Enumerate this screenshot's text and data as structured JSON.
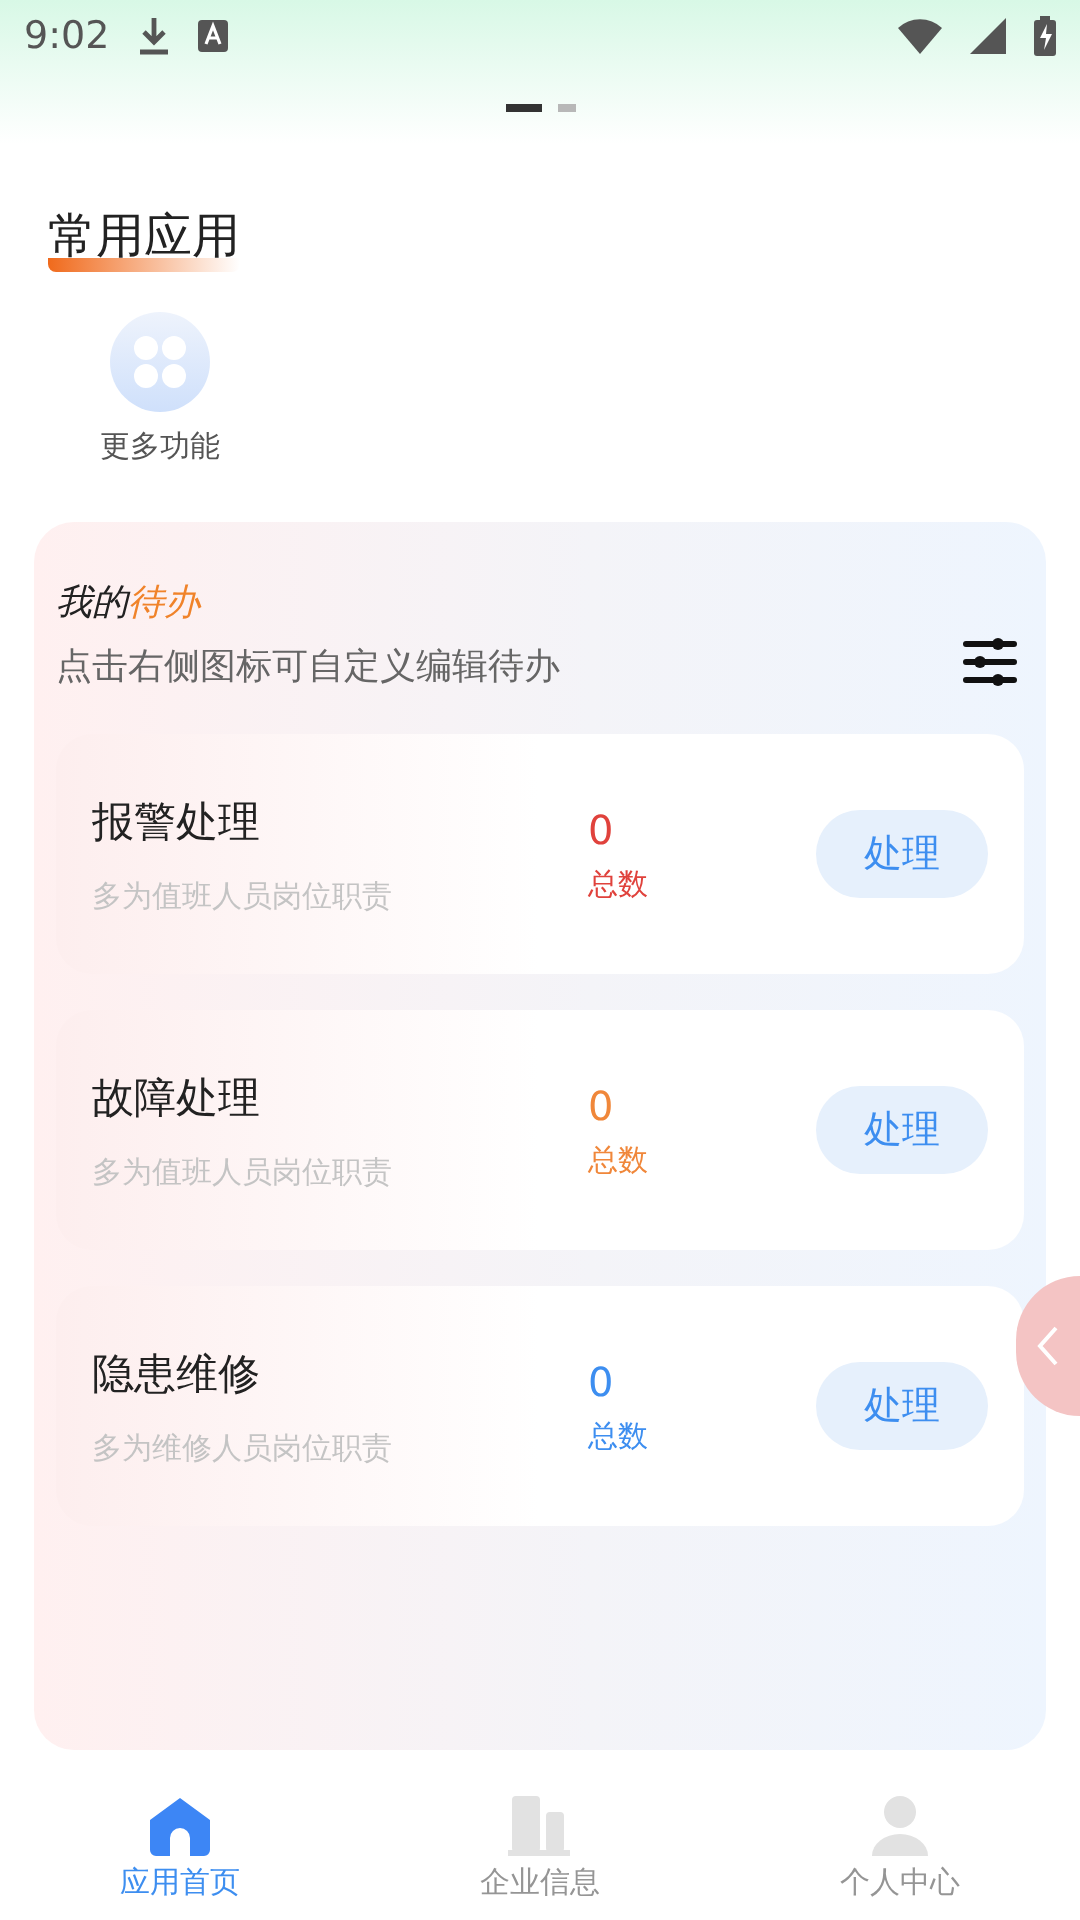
{
  "status_bar": {
    "time": "9:02"
  },
  "pager": [
    {
      "selected": true
    },
    {
      "selected": false
    }
  ],
  "section_title": "常用应用",
  "apps": [
    {
      "label": "更多功能"
    }
  ],
  "todo": {
    "title_plain": "我的",
    "title_accent": "待办",
    "hint": "点击右侧图标可自定义编辑待办",
    "tasks": [
      {
        "title": "报警处理",
        "desc": "多为值班人员岗位职责",
        "count": "0",
        "count_label": "总数",
        "color": "#e0423c",
        "action": "处理"
      },
      {
        "title": "故障处理",
        "desc": "多为值班人员岗位职责",
        "count": "0",
        "count_label": "总数",
        "color": "#f0873a",
        "action": "处理"
      },
      {
        "title": "隐患维修",
        "desc": "多为维修人员岗位职责",
        "count": "0",
        "count_label": "总数",
        "color": "#3d8ef0",
        "action": "处理"
      }
    ]
  },
  "bottom_nav": [
    {
      "kind": "home",
      "label": "应用首页",
      "selected": true
    },
    {
      "kind": "company",
      "label": "企业信息",
      "selected": false
    },
    {
      "kind": "person",
      "label": "个人中心",
      "selected": false
    }
  ]
}
